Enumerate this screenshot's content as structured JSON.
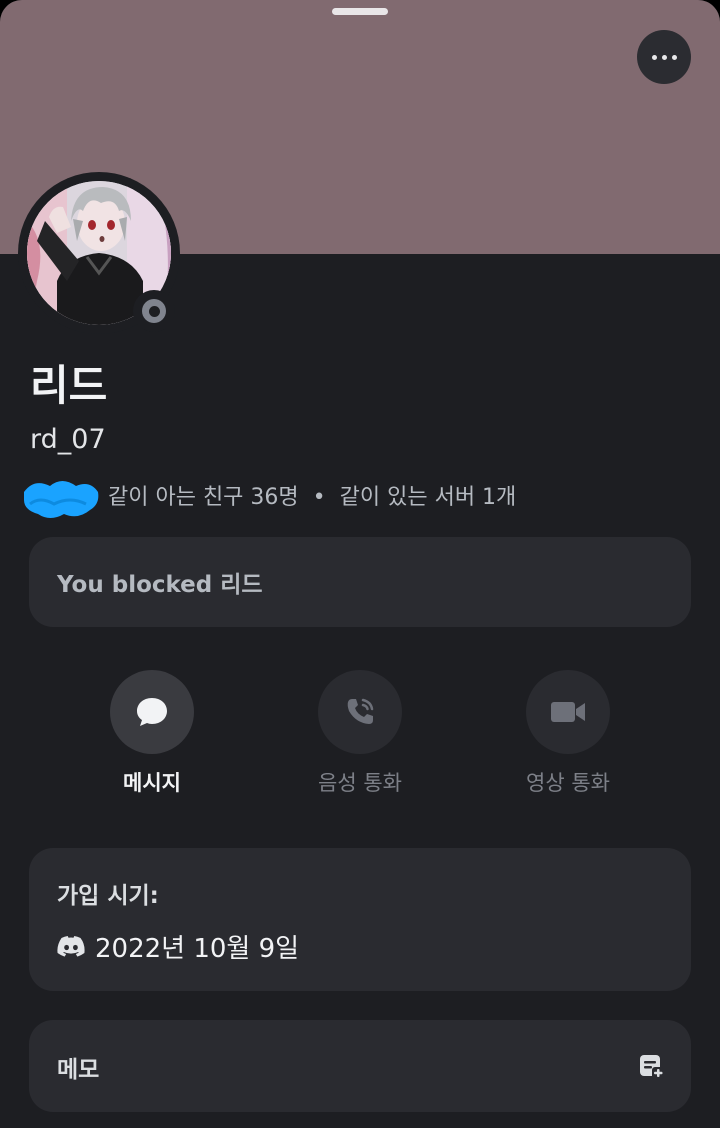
{
  "profile": {
    "display_name": "리드",
    "username": "rd_07",
    "status": "offline",
    "mutual_friends": "같이 아는 친구 36명",
    "separator": "•",
    "mutual_servers": "같이 있는 서버 1개",
    "blocked_notice": "You blocked 리드"
  },
  "actions": {
    "message": "메시지",
    "voice_call": "음성 통화",
    "video_call": "영상 통화"
  },
  "joined": {
    "title": "가입 시기:",
    "date": "2022년 10월 9일",
    "icon": "discord-logo-icon"
  },
  "memo": {
    "label": "메모",
    "icon": "note-edit-icon"
  },
  "colors": {
    "banner": "#816a70",
    "background": "#1d1e22",
    "card": "#2a2b30",
    "scribble": "#1aa3ff",
    "status_offline": "#80848e"
  }
}
